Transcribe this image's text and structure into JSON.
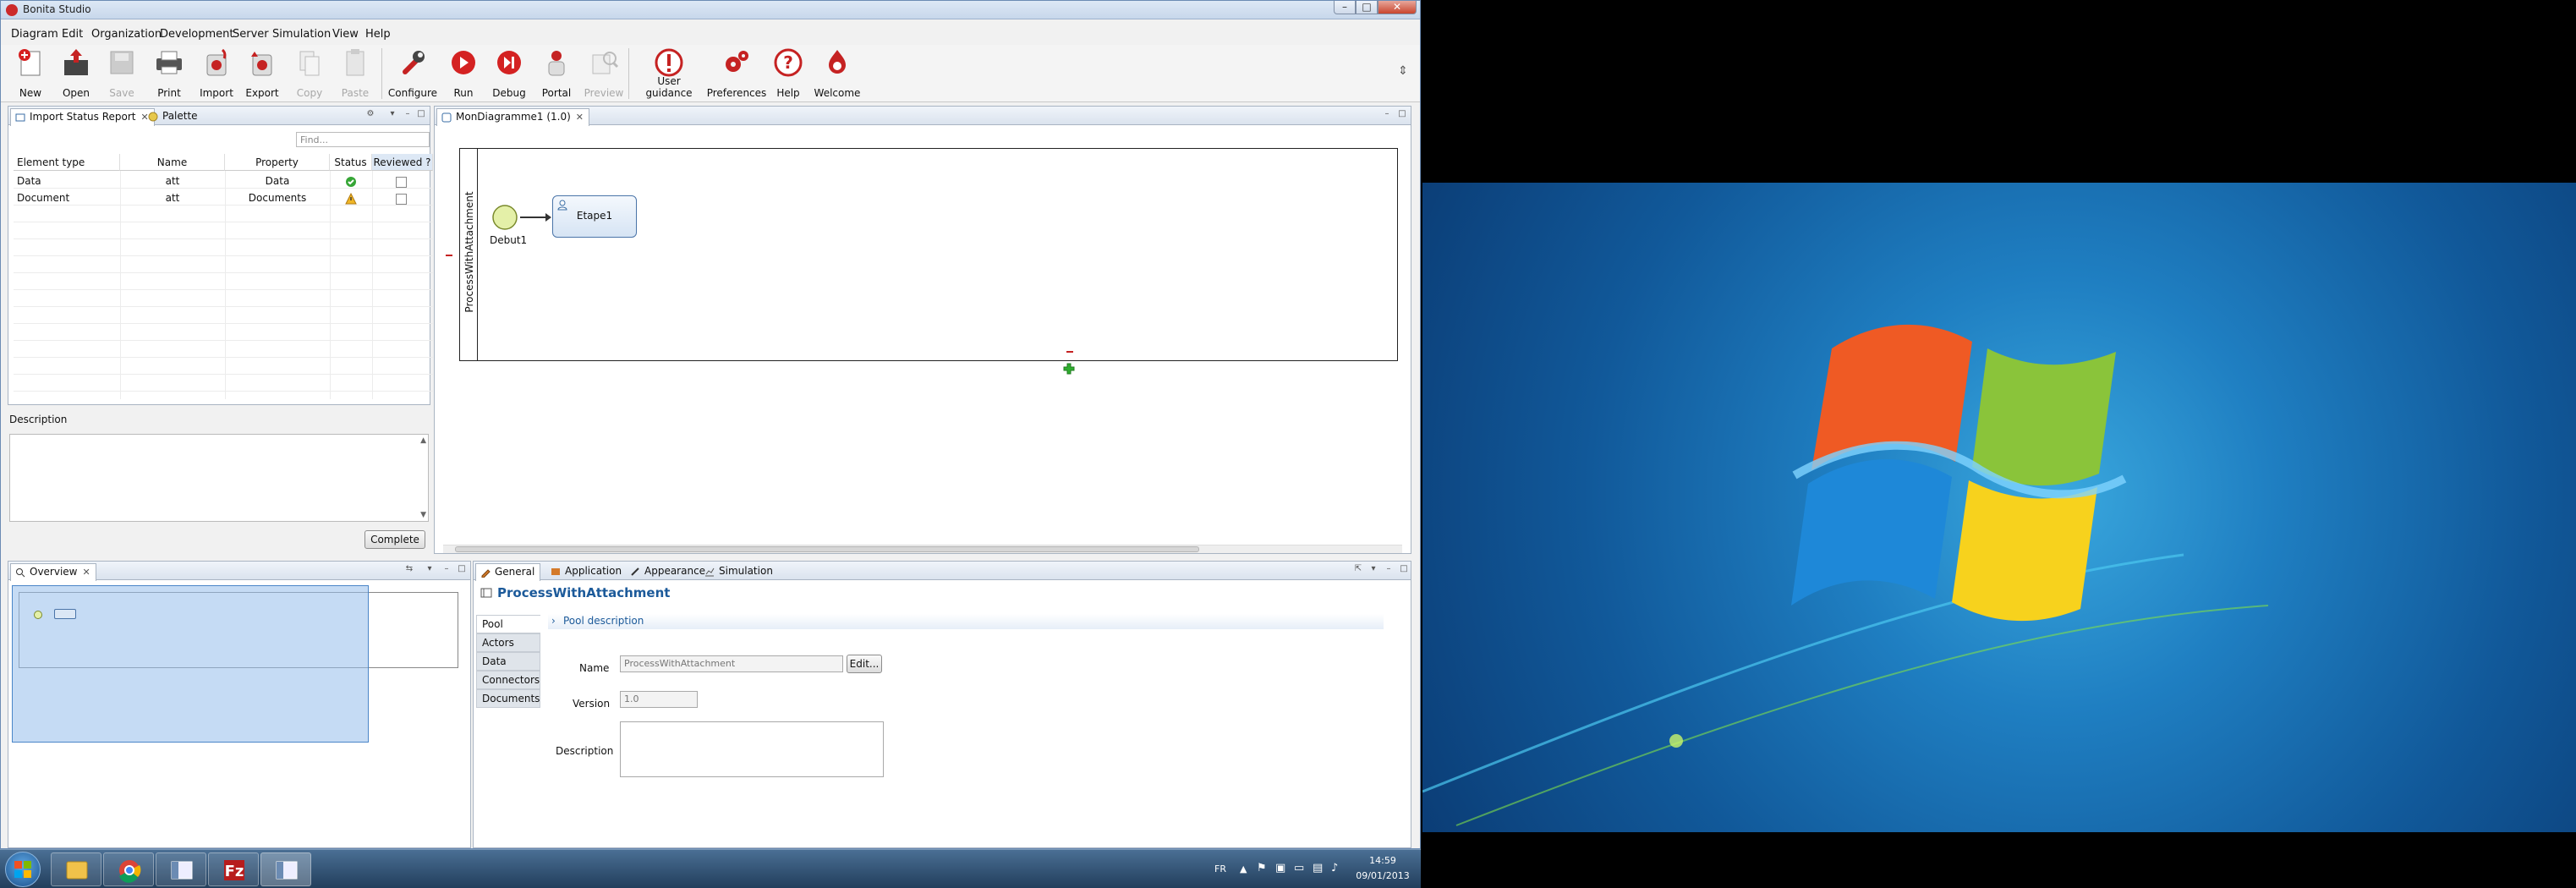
{
  "window": {
    "title": "Bonita Studio",
    "min": "–",
    "max": "□",
    "close": "✕"
  },
  "menu": [
    "Diagram",
    "Edit",
    "Organization",
    "Development",
    "Server",
    "Simulation",
    "View",
    "Help"
  ],
  "toolbar": {
    "new": "New",
    "open": "Open",
    "save": "Save",
    "print": "Print",
    "import": "Import",
    "export": "Export",
    "copy": "Copy",
    "paste": "Paste",
    "configure": "Configure",
    "run": "Run",
    "debug": "Debug",
    "portal": "Portal",
    "preview": "Preview",
    "guidance": "User guidance",
    "preferences": "Preferences",
    "help": "Help",
    "welcome": "Welcome"
  },
  "left_panel": {
    "tabs": [
      "Import Status Report",
      "Palette"
    ],
    "find_placeholder": "Find...",
    "columns": [
      "Element type",
      "Name",
      "Property",
      "Status",
      "Reviewed ?"
    ],
    "rows": [
      {
        "type": "Data",
        "name": "att",
        "property": "Data",
        "status": "ok"
      },
      {
        "type": "Document",
        "name": "att",
        "property": "Documents",
        "status": "warning"
      }
    ],
    "description_label": "Description",
    "complete_button": "Complete"
  },
  "editor": {
    "tab": "MonDiagramme1 (1.0)",
    "pool_name": "ProcessWithAttachment",
    "start_event": "Debut1",
    "task": "Etape1"
  },
  "overview": {
    "tab": "Overview"
  },
  "properties": {
    "tabs": [
      "General",
      "Application",
      "Appearance",
      "Simulation"
    ],
    "title": "ProcessWithAttachment",
    "section": "Pool description",
    "vtabs": [
      "Pool",
      "Actors",
      "Data",
      "Connectors",
      "Documents"
    ],
    "name_label": "Name",
    "name_value": "ProcessWithAttachment",
    "edit_button": "Edit...",
    "version_label": "Version",
    "version_value": "1.0",
    "description_label": "Description"
  },
  "taskbar": {
    "lang": "FR",
    "time": "14:59",
    "date": "09/01/2013"
  },
  "colors": {
    "accent": "#1c5a9a",
    "brand_red": "#cc2a2a",
    "task_fill": "#dbe7f5",
    "start_event": "#e4f0a8"
  }
}
